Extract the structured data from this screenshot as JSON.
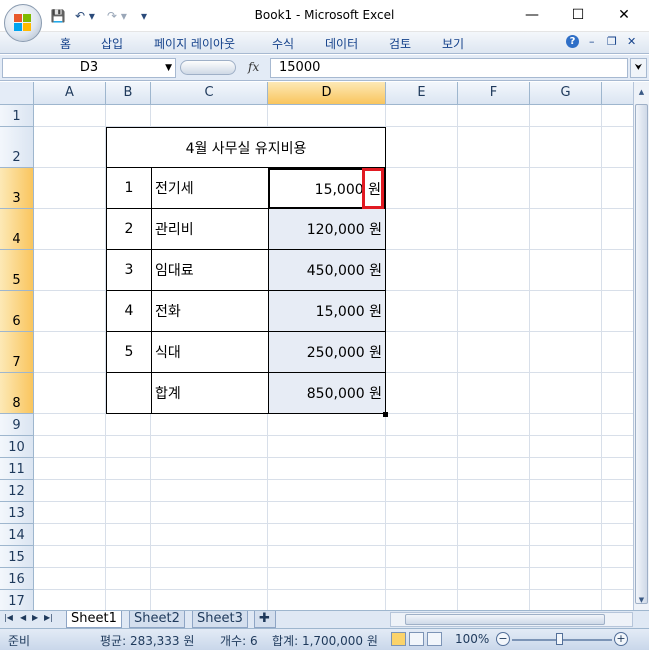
{
  "window": {
    "title": "Book1 - Microsoft Excel",
    "minimize": "—",
    "maximize": "☐",
    "close": "✕"
  },
  "qat": {
    "save": "💾",
    "undo": "↶ ▾",
    "redo": "↷ ▾",
    "customize": "▾"
  },
  "ribbon": {
    "tabs": [
      "홈",
      "삽입",
      "페이지 레이아웃",
      "수식",
      "데이터",
      "검토",
      "보기"
    ],
    "help": "?",
    "min": "–",
    "restore": "❐",
    "close": "✕"
  },
  "formula_bar": {
    "name_box": "D3",
    "fx": "fx",
    "value": "15000"
  },
  "columns": [
    "A",
    "B",
    "C",
    "D",
    "E",
    "F",
    "G"
  ],
  "selected_column": "D",
  "rows": [
    "1",
    "2",
    "3",
    "4",
    "5",
    "6",
    "7",
    "8",
    "9",
    "10",
    "11",
    "12",
    "13",
    "14",
    "15",
    "16",
    "17"
  ],
  "table": {
    "title": "4월 사무실 유지비용",
    "items": [
      {
        "no": "1",
        "name": "전기세",
        "amount": "15,000 원"
      },
      {
        "no": "2",
        "name": "관리비",
        "amount": "120,000 원"
      },
      {
        "no": "3",
        "name": "임대료",
        "amount": "450,000 원"
      },
      {
        "no": "4",
        "name": "전화",
        "amount": "15,000 원"
      },
      {
        "no": "5",
        "name": "식대",
        "amount": "250,000 원"
      }
    ],
    "total_label": "합계",
    "total_amount": "850,000 원"
  },
  "sheets": [
    "Sheet1",
    "Sheet2",
    "Sheet3"
  ],
  "active_sheet": "Sheet1",
  "status": {
    "ready": "준비",
    "average": "평균: 283,333 원",
    "count": "개수: 6",
    "sum": "합계: 1,700,000 원",
    "zoom": "100%"
  }
}
